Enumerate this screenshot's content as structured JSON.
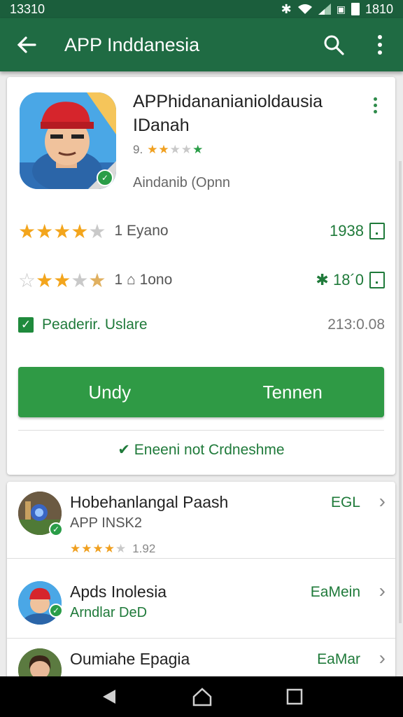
{
  "status": {
    "left_time": "13310",
    "right_time": "1810"
  },
  "appbar": {
    "title": "APP Inddanesia"
  },
  "app": {
    "name": "APPhidananianioldausia IDanah",
    "rating_label": "9.",
    "developer": "Aindanib (Opnn"
  },
  "rows": [
    {
      "label": "1 Eyano",
      "value": "1938",
      "stars": 3.5
    },
    {
      "label": "1 ⌂ 1ono",
      "value": "✱ 18´0",
      "stars": 3.5
    }
  ],
  "checkbox_row": {
    "label": "Peaderir. Uslare",
    "value": "213:0.08"
  },
  "buttons": {
    "left": "Undy",
    "right": "Tennen"
  },
  "footer_link": "✔ Eneeni not Crdneshme",
  "list": [
    {
      "title": "Hobehanlangal Paash",
      "subtitle": "APP INSK2",
      "rating": "1.92",
      "action": "EGL"
    },
    {
      "title": "Apds Inolesia",
      "subtitle": "Arndlar DeD",
      "action": "EaMein"
    },
    {
      "title": "Oumiahe Epagia",
      "subtitle": "",
      "action": "EaMar"
    }
  ],
  "colors": {
    "appbar": "#1f6b43",
    "accent": "#2f9a45",
    "star": "#f3a51c"
  }
}
